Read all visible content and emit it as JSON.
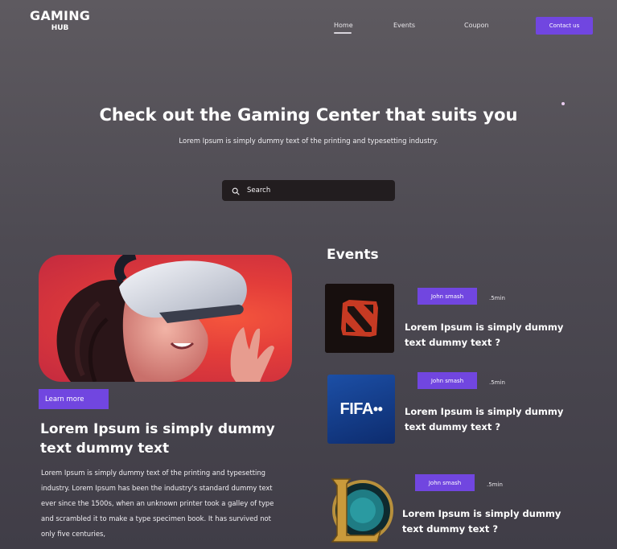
{
  "header": {
    "logo_line1": "GAMING",
    "logo_line2": "HUB",
    "nav": {
      "home": "Home",
      "events": "Events",
      "coupon": "Coupon"
    },
    "contact_label": "Contact us"
  },
  "hero": {
    "title": "Check out the Gaming Center that suits you",
    "subtitle": "Lorem Ipsum is simply dummy text of the printing and typesetting industry.",
    "search_placeholder": "Search"
  },
  "feature": {
    "learn_more_label": "Learn more",
    "title": "Lorem Ipsum is simply dummy text dummy text",
    "body": "Lorem Ipsum is simply dummy text of the printing and typesetting industry. Lorem Ipsum has been the industry's standard dummy text ever since the 1500s, when an unknown printer took a galley of type and scrambled it to make a type specimen book. It has survived not only five centuries,"
  },
  "events": {
    "heading": "Events",
    "items": [
      {
        "game": "Dota 2",
        "author": "John smash",
        "time": ".5min",
        "title": "Lorem Ipsum is simply dummy text dummy text ?"
      },
      {
        "game": "FIFA+",
        "thumb_text": "FIFA",
        "author": "John smash",
        "time": ".5min",
        "title": "Lorem Ipsum is simply dummy text dummy text ?"
      },
      {
        "game": "League of Legends",
        "author": "John smash",
        "time": ".5min",
        "title": "Lorem Ipsum is simply dummy text dummy text ?"
      }
    ]
  },
  "colors": {
    "accent": "#7146e0",
    "search_bg": "#221d1f",
    "background_top": "#5e5a60",
    "background_bottom": "#403d47"
  },
  "icons": [
    "search-icon",
    "dota-logo-icon",
    "fifa-plus-icon",
    "league-of-legends-icon"
  ]
}
